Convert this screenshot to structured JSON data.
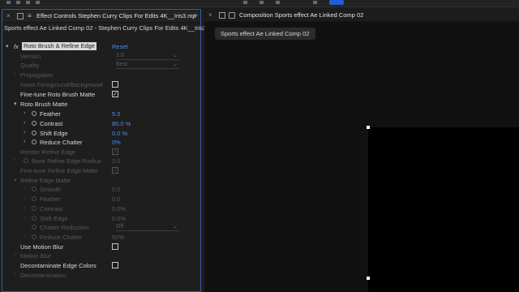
{
  "left_panel": {
    "tab_title": "Effect Controls Stephen Curry Clips For Edits 4K__Iris3.mp",
    "subtitle": "Sports effect Ae Linked Comp 02 - Stephen Curry Clips For Edits 4K__Iris3",
    "effect": {
      "fx_mark": "fx",
      "name": "Roto Brush & Refine Edge",
      "reset": "Reset"
    },
    "rows": [
      {
        "label": "Version",
        "value": "1.0"
      },
      {
        "label": "Quality",
        "value": "Best"
      },
      {
        "label": "Propagation"
      },
      {
        "label": "Invert Foreground/Background"
      },
      {
        "label": "Fine-tune Roto Brush Matte"
      },
      {
        "label": "Roto Brush Matte"
      },
      {
        "label": "Feather",
        "value": "5.0"
      },
      {
        "label": "Contrast",
        "value": "80.0 %"
      },
      {
        "label": "Shift Edge",
        "value": "0.0 %"
      },
      {
        "label": "Reduce Chatter",
        "value": "0%"
      },
      {
        "label": "Render Refine Edge"
      },
      {
        "label": "Base Refine Edge Radius",
        "value": "0.0"
      },
      {
        "label": "Fine-tune Refine Edge Matte"
      },
      {
        "label": "Refine Edge Matte"
      },
      {
        "label": "Smooth",
        "value": "0.0"
      },
      {
        "label": "Feather",
        "value": "0.0"
      },
      {
        "label": "Contrast",
        "value": "0.0%"
      },
      {
        "label": "Shift Edge",
        "value": "0.0%"
      },
      {
        "label": "Chatter Reduction",
        "value": "Off"
      },
      {
        "label": "Reduce Chatter",
        "value": "50%"
      },
      {
        "label": "Use Motion Blur"
      },
      {
        "label": "Motion Blur"
      },
      {
        "label": "Decontaminate Edge Colors"
      },
      {
        "label": "Decontamination"
      }
    ]
  },
  "right_panel": {
    "tab_title": "Composition Sports effect Ae Linked Comp 02",
    "comp_tab": "Sports effect Ae Linked Comp 02"
  },
  "colors": {
    "accent": "#2f5fa8",
    "value_blue": "#4a8ff0",
    "panel_bg": "#1e1e1e",
    "viewer_bg": "#111111"
  },
  "icons": [
    "close-icon",
    "lock-icon",
    "menu-icon",
    "stopwatch-icon",
    "twirl-arrow-icon",
    "checkbox-icon",
    "chevron-down-icon"
  ]
}
